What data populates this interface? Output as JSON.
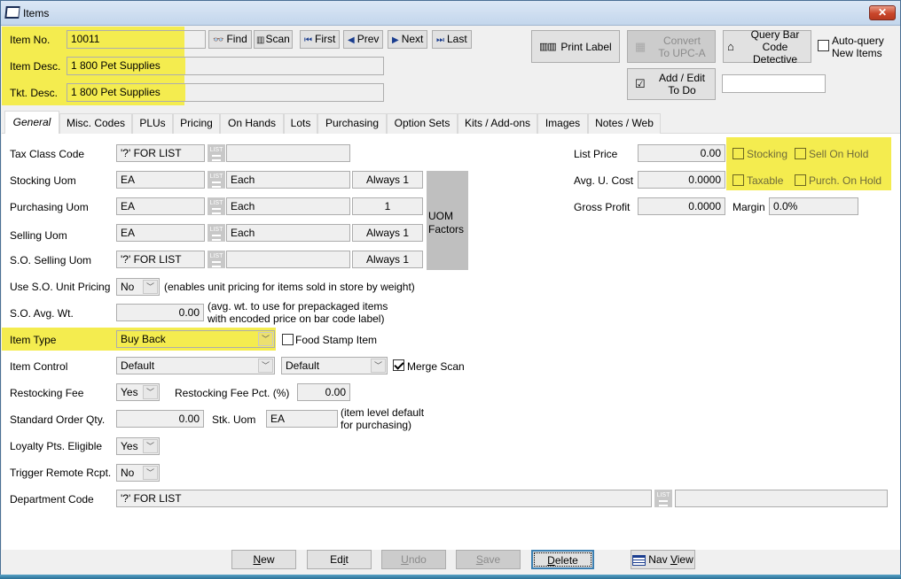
{
  "window": {
    "title": "Items",
    "close_label": "✕"
  },
  "header": {
    "item_no": {
      "label": "Item No.",
      "value": "10011"
    },
    "item_desc": {
      "label": "Item Desc.",
      "value": "1 800 Pet Supplies"
    },
    "tkt_desc": {
      "label": "Tkt. Desc.",
      "value": "1 800 Pet Supplies"
    },
    "nav_buttons": [
      {
        "label": "Find",
        "icon": "binoculars-icon",
        "glyph": "👓"
      },
      {
        "label": "Scan",
        "icon": "barcode-scan-icon",
        "glyph": "▥"
      },
      {
        "label": "First",
        "icon": "first-icon",
        "glyph": "⏮"
      },
      {
        "label": "Prev",
        "icon": "prev-icon",
        "glyph": "◀"
      },
      {
        "label": "Next",
        "icon": "next-icon",
        "glyph": "▶"
      },
      {
        "label": "Last",
        "icon": "last-icon",
        "glyph": "⏭"
      }
    ],
    "print_label": "Print Label",
    "convert_line1": "Convert",
    "convert_line2": "To UPC-A",
    "query_line1": "Query Bar",
    "query_line2": "Code Detective",
    "auto_query_line1": "Auto-query",
    "auto_query_line2": "New Items",
    "add_edit_line1": "Add / Edit",
    "add_edit_line2": "To Do",
    "todo_value": ""
  },
  "tabs": [
    "General",
    "Misc. Codes",
    "PLUs",
    "Pricing",
    "On Hands",
    "Lots",
    "Purchasing",
    "Option Sets",
    "Kits / Add-ons",
    "Images",
    "Notes / Web"
  ],
  "active_tab": "General",
  "general": {
    "tax_class": {
      "label": "Tax Class Code",
      "code": "'?' FOR LIST",
      "desc": ""
    },
    "stocking_uom": {
      "label": "Stocking Uom",
      "code": "EA",
      "desc": "Each",
      "factor": "Always 1"
    },
    "purchasing_uom": {
      "label": "Purchasing Uom",
      "code": "EA",
      "desc": "Each",
      "factor": "1"
    },
    "selling_uom": {
      "label": "Selling Uom",
      "code": "EA",
      "desc": "Each",
      "factor": "Always 1"
    },
    "so_selling_uom": {
      "label": "S.O. Selling Uom",
      "code": "'?' FOR LIST",
      "desc": "",
      "factor": "Always 1"
    },
    "uom_factors_line1": "UOM",
    "uom_factors_line2": "Factors",
    "list_icon_text": "LIST",
    "use_so_unit_pricing": {
      "label": "Use S.O. Unit Pricing",
      "value": "No",
      "note": "(enables unit pricing for items sold in store by weight)"
    },
    "so_avg_wt": {
      "label": "S.O. Avg. Wt.",
      "value": "0.00",
      "note1": "(avg. wt. to use for prepackaged items",
      "note2": "with encoded price on bar code label)"
    },
    "item_type": {
      "label": "Item Type",
      "value": "Buy Back"
    },
    "food_stamp": {
      "label": "Food Stamp Item",
      "checked": false
    },
    "item_control": {
      "label": "Item Control",
      "value1": "Default",
      "value2": "Default"
    },
    "merge_scan": {
      "label": "Merge Scan",
      "checked": true
    },
    "restocking_fee": {
      "label": "Restocking Fee",
      "value": "Yes"
    },
    "restocking_fee_pct": {
      "label": "Restocking Fee Pct. (%)",
      "value": "0.00"
    },
    "standard_order_qty": {
      "label": "Standard Order Qty.",
      "value": "0.00"
    },
    "stk_uom": {
      "label": "Stk. Uom",
      "value": "EA",
      "note1": "(item level default",
      "note2": "for purchasing)"
    },
    "loyalty": {
      "label": "Loyalty Pts. Eligible",
      "value": "Yes"
    },
    "trigger_remote": {
      "label": "Trigger Remote Rcpt.",
      "value": "No"
    },
    "department": {
      "label": "Department Code",
      "code": "'?' FOR LIST",
      "desc": ""
    },
    "list_price": {
      "label": "List Price",
      "value": "0.00"
    },
    "avg_u_cost": {
      "label": "Avg. U. Cost",
      "value": "0.0000"
    },
    "gross_profit": {
      "label": "Gross Profit",
      "value": "0.0000"
    },
    "margin": {
      "label": "Margin",
      "value": "0.0%"
    },
    "flags": [
      {
        "label": "Stocking",
        "checked": false
      },
      {
        "label": "Sell On Hold",
        "checked": false
      },
      {
        "label": "Taxable",
        "checked": false
      },
      {
        "label": "Purch. On Hold",
        "checked": false
      }
    ]
  },
  "footer": {
    "new": {
      "pre": "",
      "u": "N",
      "post": "ew"
    },
    "edit": {
      "pre": "Ed",
      "u": "i",
      "post": "t"
    },
    "undo": {
      "pre": "",
      "u": "U",
      "post": "ndo"
    },
    "save": {
      "pre": "",
      "u": "S",
      "post": "ave"
    },
    "delete": {
      "pre": "",
      "u": "D",
      "post": "elete"
    },
    "nav_view": {
      "pre": "Nav ",
      "u": "V",
      "post": "iew"
    }
  },
  "colors": {
    "highlight": "#f4ec4f",
    "focus_border": "#3c7fb1"
  }
}
